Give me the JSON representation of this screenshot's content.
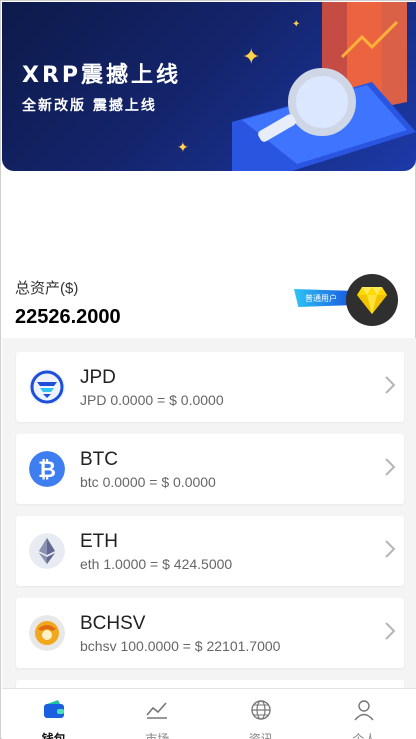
{
  "banner": {
    "title": "XRP震撼上线",
    "subtitle": "全新改版 震撼上线"
  },
  "summary": {
    "label": "总资产($)",
    "value": "22526.2000",
    "badge": "普通用户"
  },
  "assets": [
    {
      "name": "JPD",
      "balance": "JPD 0.0000 = $ 0.0000",
      "icon": "jpd-logo-icon"
    },
    {
      "name": "BTC",
      "balance": "btc 0.0000 = $ 0.0000",
      "icon": "btc-logo-icon"
    },
    {
      "name": "ETH",
      "balance": "eth 1.0000 = $ 424.5000",
      "icon": "eth-logo-icon"
    },
    {
      "name": "BCHSV",
      "balance": "bchsv 100.0000 = $ 22101.7000",
      "icon": "bchsv-logo-icon"
    }
  ],
  "tabs": [
    {
      "label": "钱包",
      "icon": "wallet-icon"
    },
    {
      "label": "市场",
      "icon": "chart-icon"
    },
    {
      "label": "资讯",
      "icon": "globe-icon"
    },
    {
      "label": "个人",
      "icon": "user-icon"
    }
  ],
  "colors": {
    "accent": "#1a5fe0",
    "banner": "#14246b"
  }
}
